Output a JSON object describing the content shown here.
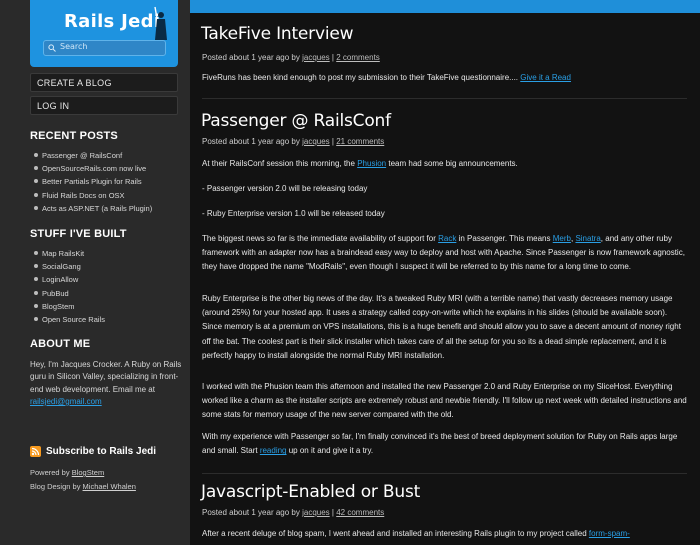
{
  "brand": {
    "title": "Rails Jedi"
  },
  "search": {
    "placeholder": "Search"
  },
  "sidebar": {
    "buttons": [
      "CREATE A BLOG",
      "LOG IN"
    ],
    "recent_heading": "RECENT POSTS",
    "recent_posts": [
      "Passenger @ RailsConf",
      "OpenSourceRails.com now live",
      "Better Partials Plugin for Rails",
      "Fluid Rails Docs on OSX",
      "Acts as ASP.NET (a Rails Plugin)"
    ],
    "built_heading": "STUFF I'VE BUILT",
    "built_items": [
      "Map RailsKit",
      "SocialGang",
      "LoginAllow",
      "PubBud",
      "BlogStem",
      "Open Source Rails"
    ],
    "about_heading": "ABOUT ME",
    "about_text": "Hey, I'm Jacques Crocker. A Ruby on Rails guru in Silicon Valley, specializing in front-end web development. Email me at",
    "about_email": "railsjedi@gmail.com",
    "subscribe": "Subscribe to Rails Jedi",
    "powered_prefix": "Powered by",
    "powered_link": "BlogStem",
    "design_prefix": "Blog Design by",
    "design_link": "Michael Whalen"
  },
  "posts": [
    {
      "title": "TakeFive Interview",
      "meta_prefix": "Posted about 1 year ago by",
      "author": "jacques",
      "sep": "|",
      "comments": "2 comments",
      "body": "FiveRuns has been kind enough to post my submission to their TakeFive questionnaire....",
      "body_link": "Give it a Read"
    },
    {
      "title": "Passenger @ RailsConf",
      "meta_prefix": "Posted about 1 year ago by",
      "author": "jacques",
      "sep": "|",
      "comments": "21 comments",
      "p1_a": "At their RailsConf session this morning, the",
      "p1_link": "Phusion",
      "p1_b": "team had some big announcements.",
      "p2": "- Passenger version 2.0 will be releasing today",
      "p3": "- Ruby Enterprise version 1.0 will be released today",
      "p4_a": "The biggest news so far is the immediate availability of support for",
      "p4_link1": "Rack",
      "p4_b": "in Passenger. This means",
      "p4_link2": "Merb",
      "p4_c": ",",
      "p4_link3": "Sinatra",
      "p4_d": ", and any other ruby framework with an adapter now has a braindead easy way to deploy and host with Apache. Since Passenger is now framework agnostic, they have dropped the name \"ModRails\", even though I suspect it will be referred to by this name for a long time to come.",
      "p5": "Ruby Enterprise is the other big news of the day. It's a tweaked Ruby MRI (with a terrible name) that vastly decreases memory usage (around 25%) for your hosted app. It uses a strategy called copy-on-write which he explains in his slides (should be available soon). Since memory is at a premium on VPS installations, this is a huge benefit and should allow you to save a decent amount of money right off the bat. The coolest part is their slick installer which takes care of all the setup for you so its a dead simple replacement, and it is perfectly happy to install alongside the normal Ruby MRI installation.",
      "p6": "I worked with the Phusion team this afternoon and installed the new Passenger 2.0 and Ruby Enterprise on my SliceHost. Everything worked like a charm as the installer scripts are extremely robust and newbie friendly. I'll follow up next week with detailed instructions and some stats for memory usage of the new server compared with the old.",
      "p7_a": "With my experience with Passenger so far, I'm finally convinced it's the best of breed deployment solution for Ruby on Rails apps large and small. Start",
      "p7_link": "reading",
      "p7_b": "up on it and give it a try."
    },
    {
      "title": "Javascript-Enabled or Bust",
      "meta_prefix": "Posted about 1 year ago by",
      "author": "jacques",
      "sep": "|",
      "comments": "42 comments",
      "body": "After a recent deluge of blog spam, I went ahead and installed an interesting Rails plugin to my project called",
      "body_link": "form-spam-"
    }
  ],
  "colors": {
    "accent": "#1e93e0",
    "link": "#2a9fe5",
    "background": "#121212",
    "sidebar": "#2a2a2a"
  }
}
